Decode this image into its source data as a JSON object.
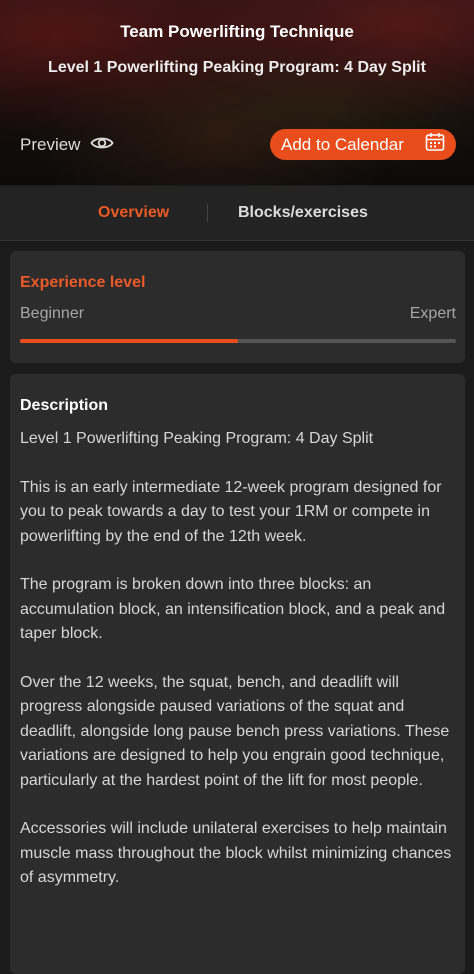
{
  "hero": {
    "title": "Team Powerlifting Technique",
    "subtitle": "Level 1 Powerlifting Peaking Program: 4 Day Split",
    "preview_label": "Preview",
    "preview_icon": "eye-icon",
    "add_calendar_label": "Add to Calendar",
    "add_calendar_icon": "calendar-icon"
  },
  "tabs": [
    {
      "label": "Overview",
      "active": true
    },
    {
      "label": "Blocks/exercises",
      "active": false
    }
  ],
  "experience": {
    "title": "Experience level",
    "min_label": "Beginner",
    "max_label": "Expert",
    "level_fraction": 0.5
  },
  "description": {
    "title": "Description",
    "paragraphs": [
      "Level 1 Powerlifting Peaking Program: 4 Day Split",
      "This is an early intermediate 12-week program designed for you to peak towards a day to test your 1RM or compete in powerlifting by the end of the 12th week.",
      "The program is broken down into three blocks: an accumulation block, an intensification block, and a peak and taper block.",
      "Over the 12 weeks, the squat, bench, and deadlift will progress alongside paused variations of the squat and deadlift, alongside long pause bench press variations. These variations are designed to help you engrain good technique, particularly at the hardest point of the lift for most people.",
      "Accessories will include unilateral exercises to help maintain muscle mass throughout the block whilst minimizing chances of asymmetry."
    ]
  },
  "colors": {
    "accent": "#ea4d1c",
    "background": "#1b1b1b",
    "card": "#2c2c2c"
  }
}
